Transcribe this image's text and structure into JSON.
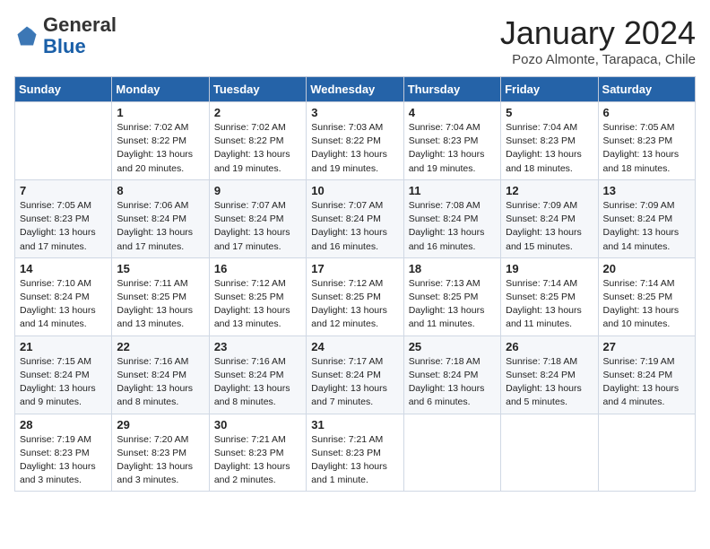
{
  "header": {
    "logo_general": "General",
    "logo_blue": "Blue",
    "month_title": "January 2024",
    "location": "Pozo Almonte, Tarapaca, Chile"
  },
  "columns": [
    "Sunday",
    "Monday",
    "Tuesday",
    "Wednesday",
    "Thursday",
    "Friday",
    "Saturday"
  ],
  "weeks": [
    [
      {
        "day": "",
        "detail": ""
      },
      {
        "day": "1",
        "detail": "Sunrise: 7:02 AM\nSunset: 8:22 PM\nDaylight: 13 hours\nand 20 minutes."
      },
      {
        "day": "2",
        "detail": "Sunrise: 7:02 AM\nSunset: 8:22 PM\nDaylight: 13 hours\nand 19 minutes."
      },
      {
        "day": "3",
        "detail": "Sunrise: 7:03 AM\nSunset: 8:22 PM\nDaylight: 13 hours\nand 19 minutes."
      },
      {
        "day": "4",
        "detail": "Sunrise: 7:04 AM\nSunset: 8:23 PM\nDaylight: 13 hours\nand 19 minutes."
      },
      {
        "day": "5",
        "detail": "Sunrise: 7:04 AM\nSunset: 8:23 PM\nDaylight: 13 hours\nand 18 minutes."
      },
      {
        "day": "6",
        "detail": "Sunrise: 7:05 AM\nSunset: 8:23 PM\nDaylight: 13 hours\nand 18 minutes."
      }
    ],
    [
      {
        "day": "7",
        "detail": "Sunrise: 7:05 AM\nSunset: 8:23 PM\nDaylight: 13 hours\nand 17 minutes."
      },
      {
        "day": "8",
        "detail": "Sunrise: 7:06 AM\nSunset: 8:24 PM\nDaylight: 13 hours\nand 17 minutes."
      },
      {
        "day": "9",
        "detail": "Sunrise: 7:07 AM\nSunset: 8:24 PM\nDaylight: 13 hours\nand 17 minutes."
      },
      {
        "day": "10",
        "detail": "Sunrise: 7:07 AM\nSunset: 8:24 PM\nDaylight: 13 hours\nand 16 minutes."
      },
      {
        "day": "11",
        "detail": "Sunrise: 7:08 AM\nSunset: 8:24 PM\nDaylight: 13 hours\nand 16 minutes."
      },
      {
        "day": "12",
        "detail": "Sunrise: 7:09 AM\nSunset: 8:24 PM\nDaylight: 13 hours\nand 15 minutes."
      },
      {
        "day": "13",
        "detail": "Sunrise: 7:09 AM\nSunset: 8:24 PM\nDaylight: 13 hours\nand 14 minutes."
      }
    ],
    [
      {
        "day": "14",
        "detail": "Sunrise: 7:10 AM\nSunset: 8:24 PM\nDaylight: 13 hours\nand 14 minutes."
      },
      {
        "day": "15",
        "detail": "Sunrise: 7:11 AM\nSunset: 8:25 PM\nDaylight: 13 hours\nand 13 minutes."
      },
      {
        "day": "16",
        "detail": "Sunrise: 7:12 AM\nSunset: 8:25 PM\nDaylight: 13 hours\nand 13 minutes."
      },
      {
        "day": "17",
        "detail": "Sunrise: 7:12 AM\nSunset: 8:25 PM\nDaylight: 13 hours\nand 12 minutes."
      },
      {
        "day": "18",
        "detail": "Sunrise: 7:13 AM\nSunset: 8:25 PM\nDaylight: 13 hours\nand 11 minutes."
      },
      {
        "day": "19",
        "detail": "Sunrise: 7:14 AM\nSunset: 8:25 PM\nDaylight: 13 hours\nand 11 minutes."
      },
      {
        "day": "20",
        "detail": "Sunrise: 7:14 AM\nSunset: 8:25 PM\nDaylight: 13 hours\nand 10 minutes."
      }
    ],
    [
      {
        "day": "21",
        "detail": "Sunrise: 7:15 AM\nSunset: 8:24 PM\nDaylight: 13 hours\nand 9 minutes."
      },
      {
        "day": "22",
        "detail": "Sunrise: 7:16 AM\nSunset: 8:24 PM\nDaylight: 13 hours\nand 8 minutes."
      },
      {
        "day": "23",
        "detail": "Sunrise: 7:16 AM\nSunset: 8:24 PM\nDaylight: 13 hours\nand 8 minutes."
      },
      {
        "day": "24",
        "detail": "Sunrise: 7:17 AM\nSunset: 8:24 PM\nDaylight: 13 hours\nand 7 minutes."
      },
      {
        "day": "25",
        "detail": "Sunrise: 7:18 AM\nSunset: 8:24 PM\nDaylight: 13 hours\nand 6 minutes."
      },
      {
        "day": "26",
        "detail": "Sunrise: 7:18 AM\nSunset: 8:24 PM\nDaylight: 13 hours\nand 5 minutes."
      },
      {
        "day": "27",
        "detail": "Sunrise: 7:19 AM\nSunset: 8:24 PM\nDaylight: 13 hours\nand 4 minutes."
      }
    ],
    [
      {
        "day": "28",
        "detail": "Sunrise: 7:19 AM\nSunset: 8:23 PM\nDaylight: 13 hours\nand 3 minutes."
      },
      {
        "day": "29",
        "detail": "Sunrise: 7:20 AM\nSunset: 8:23 PM\nDaylight: 13 hours\nand 3 minutes."
      },
      {
        "day": "30",
        "detail": "Sunrise: 7:21 AM\nSunset: 8:23 PM\nDaylight: 13 hours\nand 2 minutes."
      },
      {
        "day": "31",
        "detail": "Sunrise: 7:21 AM\nSunset: 8:23 PM\nDaylight: 13 hours\nand 1 minute."
      },
      {
        "day": "",
        "detail": ""
      },
      {
        "day": "",
        "detail": ""
      },
      {
        "day": "",
        "detail": ""
      }
    ]
  ]
}
